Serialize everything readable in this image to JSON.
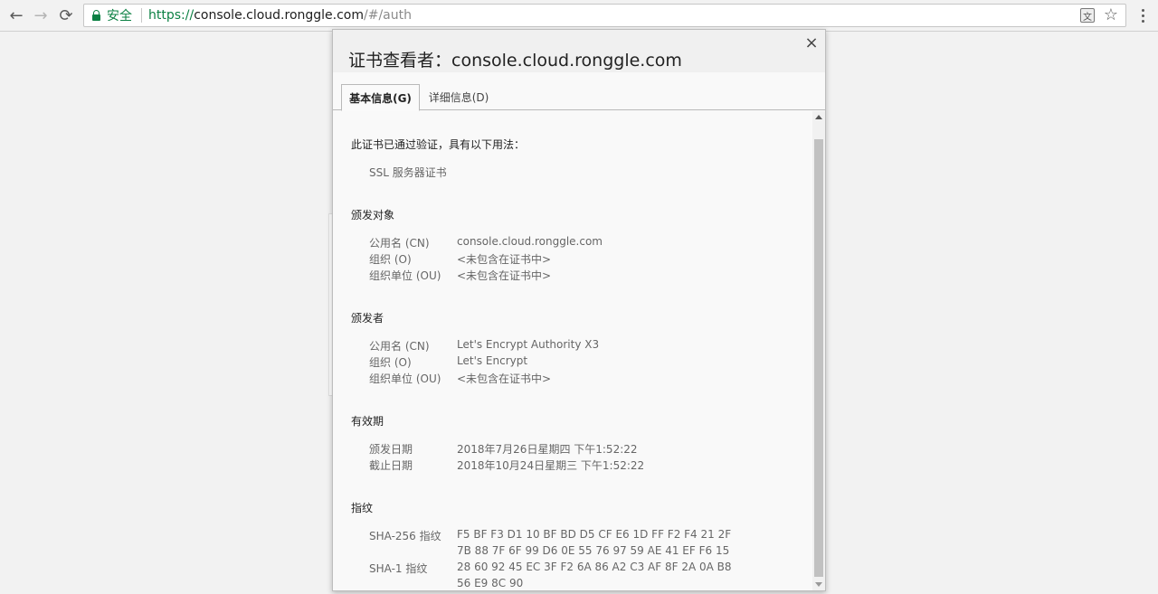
{
  "browser": {
    "secure_label": "安全",
    "url_scheme": "https://",
    "url_host": "console.cloud.ronggle.com",
    "url_path": "/#/auth",
    "back_icon": "←",
    "forward_icon": "→",
    "reload_icon": "⟳",
    "translate_icon": "文",
    "star_icon": "☆"
  },
  "dialog": {
    "title": "证书查看者：console.cloud.ronggle.com",
    "close_icon": "×",
    "tabs": [
      {
        "label": "基本信息(G)",
        "active": true
      },
      {
        "label": "详细信息(D)",
        "active": false
      }
    ],
    "verified_heading": "此证书已通过验证，具有以下用法：",
    "usage": "SSL 服务器证书",
    "issued_to": {
      "heading": "颁发对象",
      "rows": [
        {
          "label": "公用名 (CN)",
          "value": "console.cloud.ronggle.com"
        },
        {
          "label": "组织 (O)",
          "value": "<未包含在证书中>"
        },
        {
          "label": "组织单位 (OU)",
          "value": "<未包含在证书中>"
        }
      ]
    },
    "issued_by": {
      "heading": "颁发者",
      "rows": [
        {
          "label": "公用名 (CN)",
          "value": "Let's Encrypt Authority X3"
        },
        {
          "label": "组织 (O)",
          "value": "Let's Encrypt"
        },
        {
          "label": "组织单位 (OU)",
          "value": "<未包含在证书中>"
        }
      ]
    },
    "validity": {
      "heading": "有效期",
      "rows": [
        {
          "label": "颁发日期",
          "value": "2018年7月26日星期四 下午1:52:22"
        },
        {
          "label": "截止日期",
          "value": "2018年10月24日星期三 下午1:52:22"
        }
      ]
    },
    "fingerprints": {
      "heading": "指纹",
      "sha256_label": "SHA-256 指纹",
      "sha256_line1": "F5 BF F3 D1 10 BF BD D5 CF E6 1D FF F2 F4 21 2F",
      "sha256_line2": "7B 88 7F 6F 99 D6 0E 55 76 97 59 AE 41 EF F6 15",
      "sha1_label": "SHA-1 指纹",
      "sha1_line1": "28 60 92 45 EC 3F F2 6A 86 A2 C3 AF 8F 2A 0A B8",
      "sha1_line2": "56 E9 8C 90"
    }
  }
}
